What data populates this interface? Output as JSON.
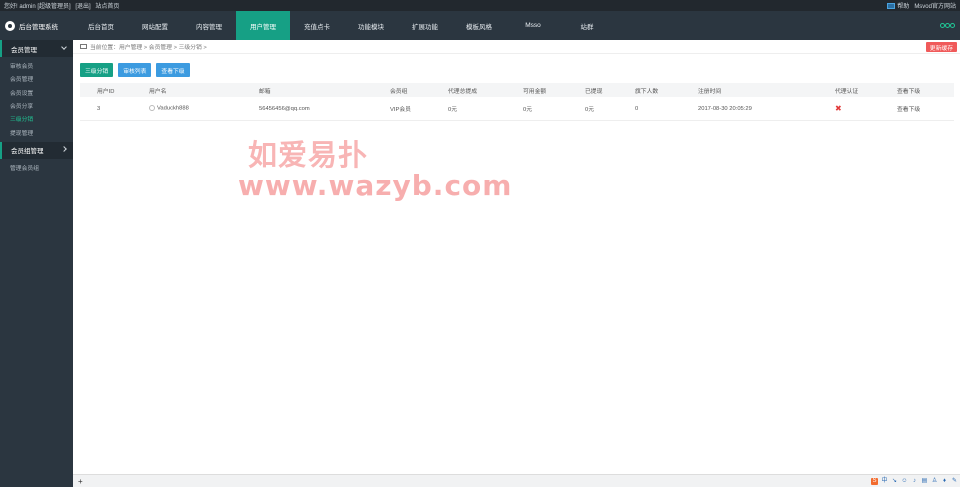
{
  "topbar": {
    "greeting": "您好! admin [超级管理员]",
    "logout": "[退出]",
    "site_home": "站点首页",
    "help": "帮助",
    "official_site": "Msvod官方网站"
  },
  "brand": {
    "title": "后台管理系统"
  },
  "nav": {
    "items": [
      {
        "label": "后台首页"
      },
      {
        "label": "网站配置"
      },
      {
        "label": "内容管理"
      },
      {
        "label": "用户管理"
      },
      {
        "label": "充值点卡"
      },
      {
        "label": "功能模块"
      },
      {
        "label": "扩展功能"
      },
      {
        "label": "模板风格"
      },
      {
        "label": "Msso"
      },
      {
        "label": "站群"
      }
    ],
    "active": "用户管理"
  },
  "sidebar": {
    "group1": "会员管理",
    "items1": [
      {
        "label": "审核会员"
      },
      {
        "label": "会员管理"
      },
      {
        "label": "会员设置"
      },
      {
        "label": "会员分享"
      },
      {
        "label": "三级分销"
      },
      {
        "label": "提现管理"
      }
    ],
    "active": "三级分销",
    "group2": "会员组管理",
    "items2": [
      {
        "label": "管理会员组"
      }
    ]
  },
  "breadcrumb": {
    "text": "当前位置：用户管理 > 会员管理 > 三级分销 >"
  },
  "refresh_button": "更新缓存",
  "buttons": {
    "distribution": "三级分销",
    "audit_list": "审核列表",
    "view_downline": "查看下级"
  },
  "table": {
    "headers": [
      "用户ID",
      "用户名",
      "邮箱",
      "会员组",
      "代理总提成",
      "可用金额",
      "已提现",
      "旗下人数",
      "注册时间",
      "代理认证",
      "查看下级"
    ],
    "rows": [
      {
        "id": "3",
        "username": "Vaduckh888",
        "email": "56456456@qq.com",
        "group": "VIP会员",
        "total_commission": "0元",
        "available": "0元",
        "withdrawn": "0元",
        "members": "0",
        "reg_time": "2017-08-30 20:05:29",
        "verified": "✖",
        "action": "查看下级"
      }
    ]
  },
  "watermark": {
    "line1": "如爱易扑",
    "line2": "www.wazyb.com"
  },
  "bottombar": {
    "plus": "+"
  },
  "tray": [
    "S",
    "中",
    "↘",
    "☺",
    "♪",
    "▤",
    "♙",
    "♦",
    "✎"
  ]
}
